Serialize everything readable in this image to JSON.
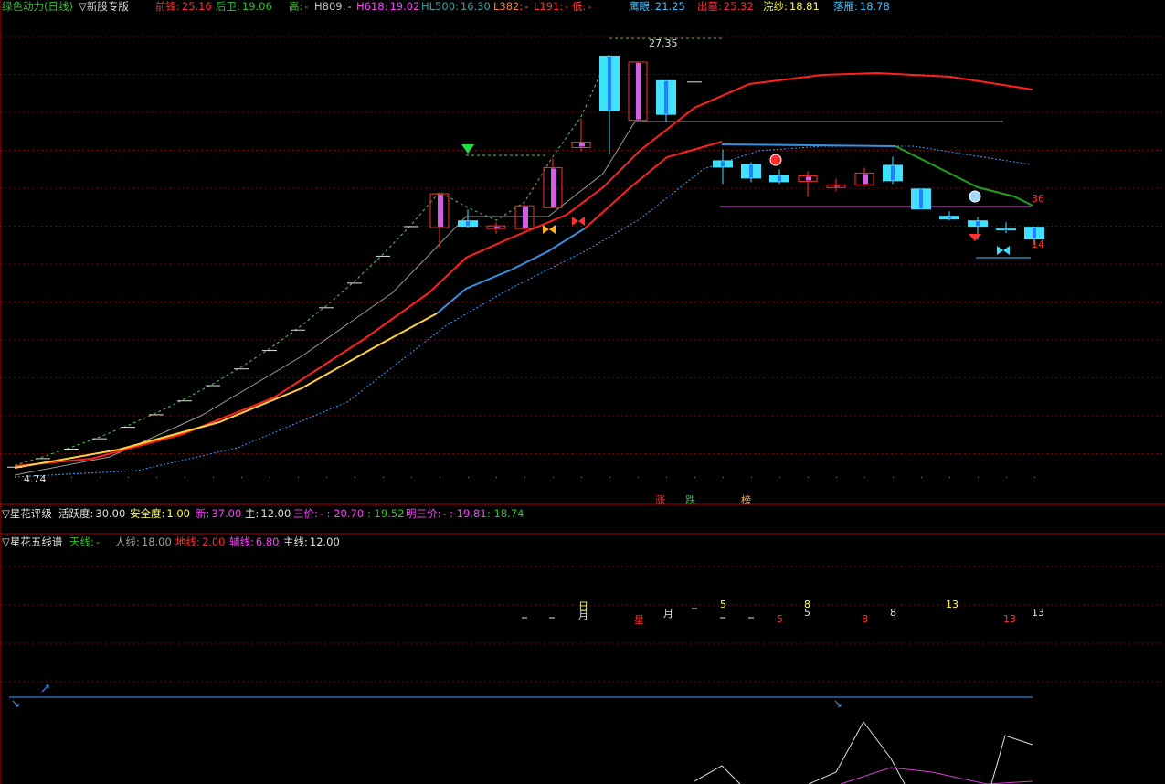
{
  "colors": {
    "red": "#ff2020",
    "yellow": "#ffff40",
    "green": "#30c030",
    "cyan": "#40e0ff",
    "magenta": "#ff40ff",
    "white": "#e0e0e0",
    "grey": "#a0a0a0",
    "orange": "#ff8000",
    "blue": "#3aa0ff",
    "panel_line": "#b00000"
  },
  "main_header": {
    "title": "绿色动力(日线)",
    "tab": "▽新股专版",
    "items": [
      {
        "label": "前锋:",
        "value": "25.16",
        "color": "#ff3030"
      },
      {
        "label": "后卫:",
        "value": "19.06",
        "color": "#30c030"
      },
      {
        "label": "高:",
        "value": "-",
        "color": "#30c030"
      },
      {
        "label": "H809:",
        "value": "-",
        "color": "#c0c0c0"
      },
      {
        "label": "H618:",
        "value": "19.02",
        "color": "#ff40ff"
      },
      {
        "label": "HL500:",
        "value": "16.30",
        "color": "#40a0a0"
      },
      {
        "label": "L382:",
        "value": "-",
        "color": "#ff8040"
      },
      {
        "label": "L191:",
        "value": "-",
        "color": "#ff3030"
      },
      {
        "label": "低:",
        "value": "-",
        "color": "#ff3030"
      },
      {
        "label": "鹰眼:",
        "value": "21.25",
        "color": "#40c0ff"
      },
      {
        "label": "出墓:",
        "value": "25.32",
        "color": "#ff3030"
      },
      {
        "label": "浣纱:",
        "value": "18.81",
        "color": "#ffff40"
      },
      {
        "label": "落雁:",
        "value": "18.78",
        "color": "#40c0ff"
      }
    ]
  },
  "chart_labels": {
    "high_price": "27.35",
    "low_price": "4.74",
    "num_36": "36",
    "num_14": "14",
    "zhang": "涨",
    "die": "跌",
    "bang": "榜"
  },
  "panel2": {
    "title": "▽星花评级",
    "items": [
      {
        "label": "活跃度:",
        "value": "30.00",
        "color": "#e0e0e0"
      },
      {
        "label": "安全度:",
        "value": "1.00",
        "color": "#ffff40"
      },
      {
        "label": "新:",
        "value": "37.00",
        "color": "#ff40ff"
      },
      {
        "label": "主:",
        "value": "12.00",
        "color": "#e0e0e0"
      },
      {
        "label": "三价:",
        "value": "- : 20.70",
        "color": "#ff40ff"
      },
      {
        "label": "",
        "value": ": 19.52",
        "color": "#30c030"
      },
      {
        "label": "明三价:",
        "value": "- : 19.81",
        "color": "#ff40ff"
      },
      {
        "label": "",
        "value": ": 18.74",
        "color": "#30c030"
      }
    ]
  },
  "panel3": {
    "title": "▽星花五线谱",
    "items": [
      {
        "label": "天线:",
        "value": "-",
        "color": "#30c030"
      },
      {
        "label": "人线:",
        "value": "18.00",
        "color": "#a0a0a0"
      },
      {
        "label": "地线:",
        "value": "2.00",
        "color": "#ff3030"
      },
      {
        "label": "辅线:",
        "value": "6.80",
        "color": "#ff40ff"
      },
      {
        "label": "主线:",
        "value": "12.00",
        "color": "#e0e0e0"
      }
    ],
    "marks": [
      {
        "text": "日",
        "color": "#ffff40"
      },
      {
        "text": "月",
        "color": "#e0e0e0"
      },
      {
        "text": "星",
        "color": "#ff3030"
      },
      {
        "text": "月",
        "color": "#e0e0e0"
      },
      {
        "text": "5",
        "color": "#ffff40"
      },
      {
        "text": "8",
        "color": "#ffff40"
      },
      {
        "text": "5",
        "color": "#e0e0e0"
      },
      {
        "text": "5",
        "color": "#ff3030"
      },
      {
        "text": "8",
        "color": "#ff3030"
      },
      {
        "text": "8",
        "color": "#e0e0e0"
      },
      {
        "text": "13",
        "color": "#ffff40"
      },
      {
        "text": "13",
        "color": "#ff3030"
      },
      {
        "text": "13",
        "color": "#e0e0e0"
      }
    ]
  },
  "chart_data": {
    "type": "candlestick",
    "candles": [
      {
        "o": 4.74,
        "h": 4.74,
        "l": 4.74,
        "c": 4.74
      },
      {
        "o": 5.21,
        "h": 5.21,
        "l": 5.21,
        "c": 5.21
      },
      {
        "o": 5.73,
        "h": 5.73,
        "l": 5.73,
        "c": 5.73
      },
      {
        "o": 6.3,
        "h": 6.3,
        "l": 6.3,
        "c": 6.3
      },
      {
        "o": 6.93,
        "h": 6.93,
        "l": 6.93,
        "c": 6.93
      },
      {
        "o": 7.62,
        "h": 7.62,
        "l": 7.62,
        "c": 7.62
      },
      {
        "o": 8.38,
        "h": 8.38,
        "l": 8.38,
        "c": 8.38
      },
      {
        "o": 9.22,
        "h": 9.22,
        "l": 9.22,
        "c": 9.22
      },
      {
        "o": 10.14,
        "h": 10.14,
        "l": 10.14,
        "c": 10.14
      },
      {
        "o": 11.15,
        "h": 11.15,
        "l": 11.15,
        "c": 11.15
      },
      {
        "o": 12.27,
        "h": 12.27,
        "l": 12.27,
        "c": 12.27
      },
      {
        "o": 13.5,
        "h": 13.5,
        "l": 13.5,
        "c": 13.5
      },
      {
        "o": 14.85,
        "h": 14.85,
        "l": 14.85,
        "c": 14.85
      },
      {
        "o": 16.33,
        "h": 16.33,
        "l": 16.33,
        "c": 16.33
      },
      {
        "o": 17.96,
        "h": 17.96,
        "l": 17.96,
        "c": 17.96
      },
      {
        "o": 17.9,
        "h": 19.76,
        "l": 16.8,
        "c": 19.76
      },
      {
        "o": 18.3,
        "h": 18.9,
        "l": 17.9,
        "c": 17.95
      },
      {
        "o": 17.85,
        "h": 18.2,
        "l": 17.55,
        "c": 18.0
      },
      {
        "o": 17.85,
        "h": 19.2,
        "l": 17.75,
        "c": 19.1
      },
      {
        "o": 19.0,
        "h": 21.7,
        "l": 19.0,
        "c": 21.2
      },
      {
        "o": 22.3,
        "h": 23.9,
        "l": 22.1,
        "c": 22.6
      },
      {
        "o": 27.35,
        "h": 27.35,
        "l": 21.95,
        "c": 24.3
      },
      {
        "o": 23.8,
        "h": 27.0,
        "l": 23.8,
        "c": 27.0
      },
      {
        "o": 26.0,
        "h": 26.0,
        "l": 23.7,
        "c": 24.1
      },
      {
        "o": 25.9,
        "h": 25.9,
        "l": 25.9,
        "c": 25.9
      },
      {
        "o": 21.6,
        "h": 22.2,
        "l": 20.3,
        "c": 21.2
      },
      {
        "o": 21.4,
        "h": 21.5,
        "l": 20.4,
        "c": 20.6
      },
      {
        "o": 20.8,
        "h": 21.1,
        "l": 20.3,
        "c": 20.4
      },
      {
        "o": 20.45,
        "h": 21.0,
        "l": 19.6,
        "c": 20.75
      },
      {
        "o": 20.1,
        "h": 20.6,
        "l": 19.9,
        "c": 20.25
      },
      {
        "o": 20.25,
        "h": 21.2,
        "l": 20.2,
        "c": 20.9
      },
      {
        "o": 21.35,
        "h": 21.8,
        "l": 20.3,
        "c": 20.45
      },
      {
        "o": 20.05,
        "h": 20.05,
        "l": 18.9,
        "c": 18.9
      },
      {
        "o": 18.55,
        "h": 18.8,
        "l": 18.3,
        "c": 18.35
      },
      {
        "o": 18.3,
        "h": 18.5,
        "l": 17.25,
        "c": 17.95
      },
      {
        "o": 17.85,
        "h": 18.2,
        "l": 17.6,
        "c": 17.8
      },
      {
        "o": 17.95,
        "h": 17.95,
        "l": 16.95,
        "c": 17.25
      }
    ],
    "xlim": [
      0,
      36
    ],
    "ylim": [
      4.2,
      28.2
    ]
  }
}
